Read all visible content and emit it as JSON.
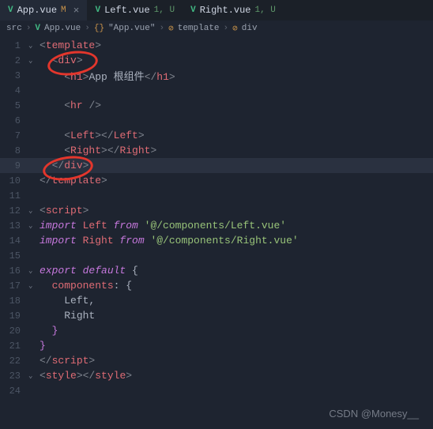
{
  "tabs": [
    {
      "icon": "V",
      "name": "App.vue",
      "status": "M",
      "active": true,
      "close": "×"
    },
    {
      "icon": "V",
      "name": "Left.vue",
      "status": "1, U"
    },
    {
      "icon": "V",
      "name": "Right.vue",
      "status": "1, U"
    }
  ],
  "crumbs": {
    "c1": "src",
    "c2": "App.vue",
    "c3": "\"App.vue\"",
    "c4": "template",
    "c5": "div",
    "sep": "›",
    "brace": "{}",
    "tagicon": "⊘"
  },
  "lines": {
    "l1": {
      "n": "1",
      "fold": "⌄",
      "a": "<",
      "b": "template",
      "c": ">"
    },
    "l2": {
      "n": "2",
      "fold": "⌄",
      "a": "<",
      "b": "div",
      "c": ">"
    },
    "l3": {
      "n": "3",
      "a": "<",
      "b": "h1",
      "c": ">",
      "t": "App 根组件",
      "d": "</",
      "e": "h1",
      "f": ">"
    },
    "l4": {
      "n": "4"
    },
    "l5": {
      "n": "5",
      "a": "<",
      "b": "hr",
      "c": " />"
    },
    "l6": {
      "n": "6"
    },
    "l7": {
      "n": "7",
      "a": "<",
      "b": "Left",
      "c": "></",
      "d": "Left",
      "e": ">"
    },
    "l8": {
      "n": "8",
      "a": "<",
      "b": "Right",
      "c": "></",
      "d": "Right",
      "e": ">"
    },
    "l9": {
      "n": "9",
      "a": "</",
      "b": "div",
      "c": ">"
    },
    "l10": {
      "n": "10",
      "a": "</",
      "b": "template",
      "c": ">"
    },
    "l11": {
      "n": "11"
    },
    "l12": {
      "n": "12",
      "fold": "⌄",
      "a": "<",
      "b": "script",
      "c": ">"
    },
    "l13": {
      "n": "13",
      "fold": "⌄",
      "k": "import",
      "v": " Left ",
      "k2": "from",
      "s": " '@/components/Left.vue'"
    },
    "l14": {
      "n": "14",
      "k": "import",
      "v": " Right ",
      "k2": "from",
      "s": " '@/components/Right.vue'"
    },
    "l15": {
      "n": "15"
    },
    "l16": {
      "n": "16",
      "fold": "⌄",
      "k": "export default",
      "b": " {"
    },
    "l17": {
      "n": "17",
      "fold": "⌄",
      "p": "components",
      "b": ": {"
    },
    "l18": {
      "n": "18",
      "t": "Left,"
    },
    "l19": {
      "n": "19",
      "t": "Right"
    },
    "l20": {
      "n": "20",
      "b": "}"
    },
    "l21": {
      "n": "21",
      "b": "}"
    },
    "l22": {
      "n": "22",
      "a": "</",
      "b": "script",
      "c": ">"
    },
    "l23": {
      "n": "23",
      "fold": "⌄",
      "a": "<",
      "b": "style",
      "c": "></",
      "d": "style",
      "e": ">"
    },
    "l24": {
      "n": "24"
    }
  },
  "watermark": "CSDN @Monesy__"
}
